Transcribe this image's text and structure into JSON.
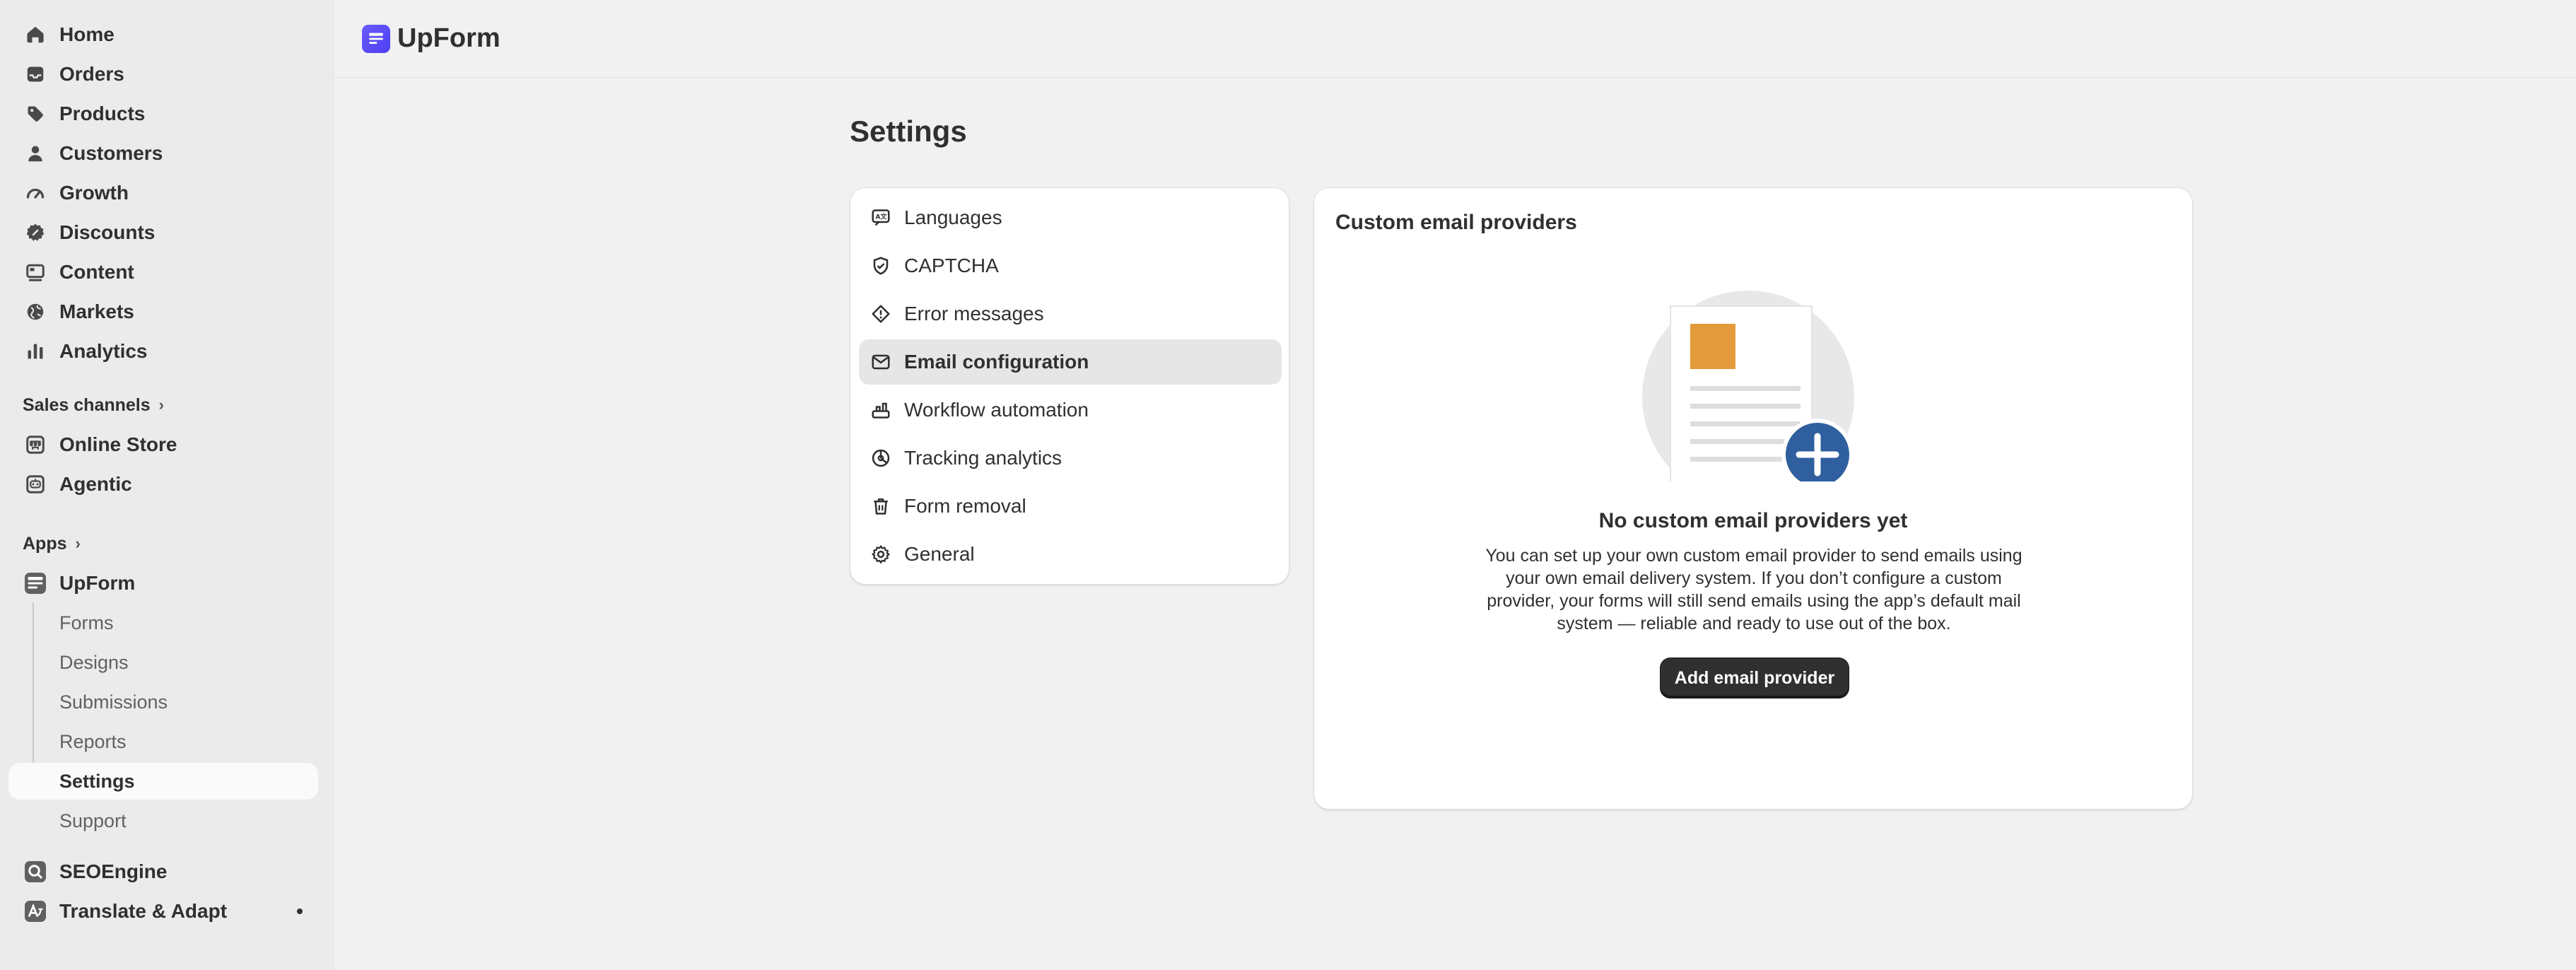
{
  "sidebar": {
    "nav": [
      {
        "label": "Home",
        "icon": "home-icon"
      },
      {
        "label": "Orders",
        "icon": "inbox-icon"
      },
      {
        "label": "Products",
        "icon": "tag-icon"
      },
      {
        "label": "Customers",
        "icon": "person-icon"
      },
      {
        "label": "Growth",
        "icon": "gauge-icon"
      },
      {
        "label": "Discounts",
        "icon": "discount-icon"
      },
      {
        "label": "Content",
        "icon": "content-icon"
      },
      {
        "label": "Markets",
        "icon": "globe-icon"
      },
      {
        "label": "Analytics",
        "icon": "bar-chart-icon"
      }
    ],
    "sales_channels": {
      "heading": "Sales channels",
      "items": [
        {
          "label": "Online Store",
          "icon": "store-icon"
        },
        {
          "label": "Agentic",
          "icon": "robot-icon"
        }
      ]
    },
    "apps": {
      "heading": "Apps",
      "upform": {
        "label": "UpForm",
        "icon": "form-app-icon"
      },
      "sub_items": [
        {
          "label": "Forms"
        },
        {
          "label": "Designs"
        },
        {
          "label": "Submissions"
        },
        {
          "label": "Reports"
        },
        {
          "label": "Settings",
          "active": true
        },
        {
          "label": "Support"
        }
      ],
      "others": [
        {
          "label": "SEOEngine",
          "icon": "seo-app-icon"
        },
        {
          "label": "Translate & Adapt",
          "icon": "translate-app-icon"
        }
      ]
    }
  },
  "topbar": {
    "app_name": "UpForm",
    "icon": "upform-logo-icon"
  },
  "page": {
    "title": "Settings"
  },
  "settings_menu": [
    {
      "label": "Languages",
      "icon": "language-icon"
    },
    {
      "label": "CAPTCHA",
      "icon": "shield-check-icon"
    },
    {
      "label": "Error messages",
      "icon": "alert-diamond-icon"
    },
    {
      "label": "Email configuration",
      "icon": "email-icon",
      "active": true
    },
    {
      "label": "Workflow automation",
      "icon": "automation-icon"
    },
    {
      "label": "Tracking analytics",
      "icon": "analytics-icon"
    },
    {
      "label": "Form removal",
      "icon": "trash-icon"
    },
    {
      "label": "General",
      "icon": "gear-icon"
    }
  ],
  "panel": {
    "title": "Custom email providers",
    "empty_title": "No custom email providers yet",
    "empty_description": "You can set up your own custom email provider to send emails using your own email delivery system. If you don’t configure a custom provider, your forms will still send emails using the app’s default mail system — reliable and ready to use out of the box.",
    "button_label": "Add email provider"
  },
  "colors": {
    "sidebar_bg": "#ebebeb",
    "page_bg": "#f1f1f1",
    "primary_button": "#303030",
    "brand_purple": "#5b4cf5",
    "plus_badge": "#2f5f9e",
    "thumb_orange": "#e39a3b"
  }
}
